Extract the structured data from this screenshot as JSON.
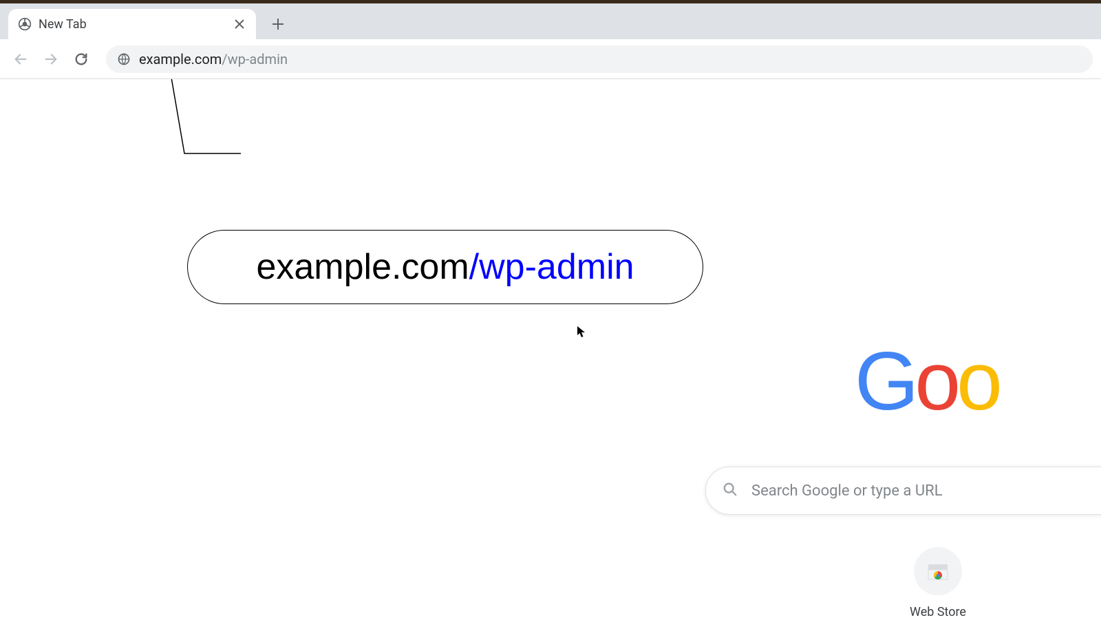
{
  "tab": {
    "title": "New Tab"
  },
  "url": {
    "domain": "example.com",
    "path": "/wp-admin"
  },
  "callout": {
    "domain": "example.com",
    "path": "/wp-admin"
  },
  "search": {
    "placeholder": "Search Google or type a URL"
  },
  "shortcut": {
    "label": "Web Store"
  },
  "logo": {
    "g": "G",
    "o1": "o",
    "o2": "o"
  }
}
